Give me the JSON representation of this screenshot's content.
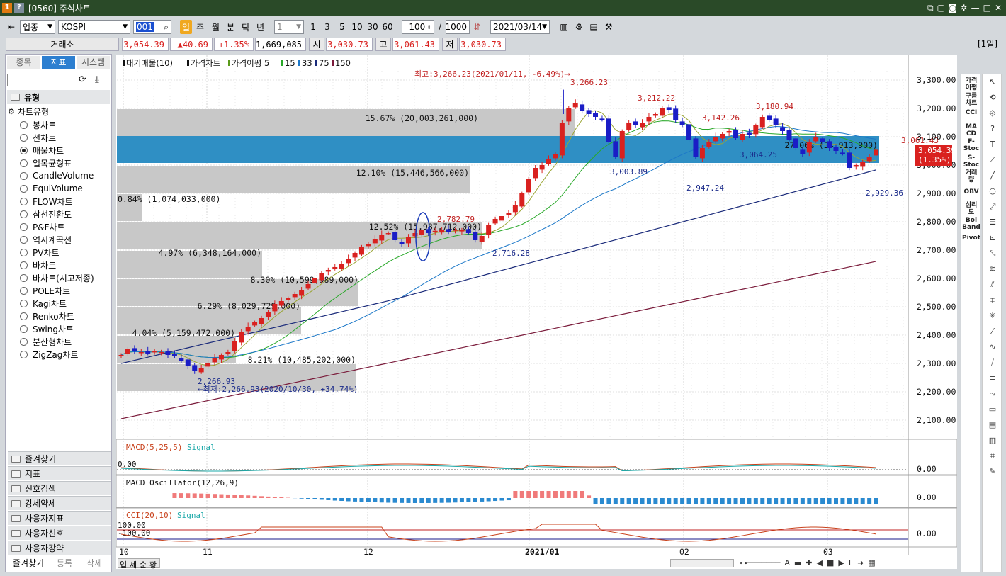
{
  "window": {
    "title": "[0560] 주식차트",
    "icon1": "1",
    "icon2": "?"
  },
  "toolbar": {
    "market_type": "업종",
    "index_name": "KOSPI",
    "code_value": "001",
    "periods": [
      "일",
      "주",
      "월",
      "분",
      "틱",
      "년"
    ],
    "interval": "1",
    "steps": [
      "1",
      "3",
      "5",
      "10",
      "30",
      "60"
    ],
    "count": "100",
    "total": "1000",
    "date": "2021/03/14",
    "period_badge": "[1일]"
  },
  "quote": {
    "exchange": "거래소",
    "price": "3,054.39",
    "change": "▲40.69",
    "change_pct": "+1.35%",
    "volume": "1,669,085",
    "open_label": "시",
    "open": "3,030.73",
    "high_label": "고",
    "high": "3,061.43",
    "low_label": "저",
    "low": "3,030.73"
  },
  "left": {
    "tabs": [
      "종목",
      "지표",
      "시스템"
    ],
    "section": "유형",
    "tree_root": "차트유형",
    "chart_types": [
      "봉차트",
      "선차트",
      "매물차트",
      "일목균형표",
      "CandleVolume",
      "EquiVolume",
      "FLOW차트",
      "삼선전환도",
      "P&F차트",
      "역시계곡선",
      "PV차트",
      "바차트",
      "바차트(시고저종)",
      "POLE차트",
      "Kagi차트",
      "Renko차트",
      "Swing차트",
      "분산형차트",
      "ZigZag차트"
    ],
    "selected_index": 2,
    "folders": [
      "즐겨찾기",
      "지표",
      "신호검색",
      "강세약세",
      "사용자지표",
      "사용자신호",
      "사용자강약"
    ],
    "bottom_tabs": [
      "즐겨찾기",
      "등록",
      "삭제"
    ]
  },
  "chart": {
    "legend": {
      "vp": "대기매물(10)",
      "price": "가격차트",
      "ma": "가격이평 5",
      "ma15": "15",
      "ma33": "33",
      "ma75": "75",
      "ma150": "150"
    },
    "yticks": [
      "3,300.00",
      "3,200.00",
      "3,100.00",
      "3,000.00",
      "2,900.00",
      "2,800.00",
      "2,700.00",
      "2,600.00",
      "2,500.00",
      "2,400.00",
      "2,300.00",
      "2,200.00",
      "2,100.00"
    ],
    "xticks": [
      "10",
      "11",
      "12",
      "2021/01",
      "02",
      "03"
    ],
    "current_price": "3,054.39",
    "current_pct": "(1.35%)",
    "max_note": "최고:3,266.23(2021/01/11, -6.49%)⟶",
    "min_note": "⟵최저:2,266.93(2020/10/30, +34.74%)",
    "annotations": {
      "a1": "3,266.23",
      "a2": "3,212.22",
      "a3": "3,142.26",
      "a4": "3,180.94",
      "a5": "3,061.43",
      "a6": "3,003.89",
      "a7": "2,947.24",
      "a8": "3,064.25",
      "a9": "2,929.36",
      "a10": "2,782.79",
      "a11": "2,716.28",
      "a12": "2,266.93"
    },
    "vp_labels": [
      "15.67% (20,003,261,000)",
      "12.10% (15,446,566,000)",
      "0.84% (1,074,033,000)",
      "12.52% (15,987,712,000)",
      "4.97% (6,348,164,000)",
      "8.30% (10,599,989,000)",
      "6.29% (8,029,729,000)",
      "4.04% (5,159,472,000)",
      "8.21% (10,485,202,000)",
      "27.06% (34,913,900)"
    ],
    "macd_title": "MACD(5,25,5)",
    "macd_signal": "Signal",
    "macd_zero": "0.00",
    "macd_right": "0.00",
    "osc_title": "MACD Oscillator(12,26,9)",
    "osc_right": "0.00",
    "cci_title": "CCI(20,10)",
    "cci_signal": "Signal",
    "cci_top": "100.00",
    "cci_mid": "-100.00",
    "cci_right": "0.00",
    "bottom_buttons": [
      "업",
      "세",
      "순",
      "황"
    ]
  },
  "indicators": [
    "가격\n이평",
    "구름\n차트",
    "CCI",
    "MA\nCD",
    "F-\nStoc",
    "S-\nStoc",
    "거래\n량",
    "OBV",
    "심리\n도",
    "Bol\nBand",
    "Pivot"
  ],
  "colors": {
    "up": "#d9211f",
    "down": "#1a1dc6",
    "band": "#2f8fc4",
    "vp": "#c8c8c8"
  }
}
